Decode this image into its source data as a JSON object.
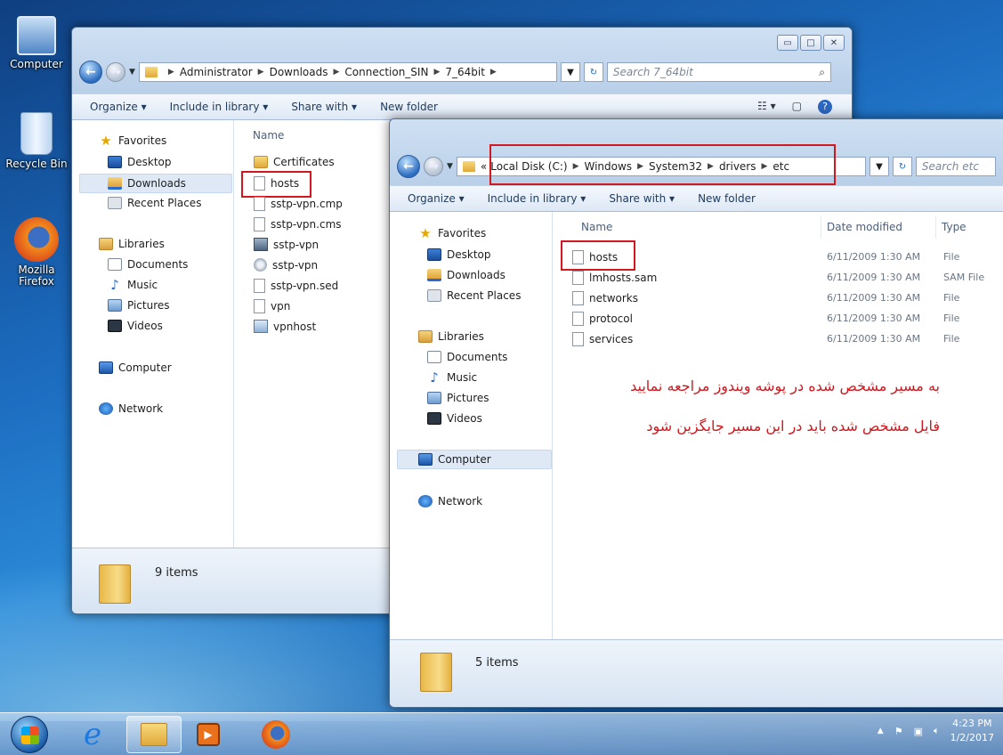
{
  "desktop": {
    "icons": [
      {
        "label": "Computer",
        "icon": "computer-icon"
      },
      {
        "label": "Recycle Bin",
        "icon": "recycle-bin-icon"
      },
      {
        "label": "Mozilla Firefox",
        "icon": "firefox-icon"
      }
    ]
  },
  "window1": {
    "breadcrumb": [
      "Administrator",
      "Downloads",
      "Connection_SIN",
      "7_64bit"
    ],
    "search_placeholder": "Search 7_64bit",
    "toolbar": {
      "organize": "Organize ▾",
      "include": "Include in library ▾",
      "share": "Share with ▾",
      "new_folder": "New folder"
    },
    "nav": {
      "favorites": "Favorites",
      "desktop": "Desktop",
      "downloads": "Downloads",
      "recent": "Recent Places",
      "libraries": "Libraries",
      "documents": "Documents",
      "music": "Music",
      "pictures": "Pictures",
      "videos": "Videos",
      "computer": "Computer",
      "network": "Network"
    },
    "column_name": "Name",
    "files": [
      "Certificates",
      "hosts",
      "sstp-vpn.cmp",
      "sstp-vpn.cms",
      "sstp-vpn",
      "sstp-vpn",
      "sstp-vpn.sed",
      "vpn",
      "vpnhost"
    ],
    "status": "9 items"
  },
  "window2": {
    "breadcrumb_prefix": "«",
    "breadcrumb": [
      "Local Disk (C:)",
      "Windows",
      "System32",
      "drivers",
      "etc"
    ],
    "search_placeholder": "Search etc",
    "toolbar": {
      "organize": "Organize ▾",
      "include": "Include in library ▾",
      "share": "Share with ▾",
      "new_folder": "New folder"
    },
    "nav": {
      "favorites": "Favorites",
      "desktop": "Desktop",
      "downloads": "Downloads",
      "recent": "Recent Places",
      "libraries": "Libraries",
      "documents": "Documents",
      "music": "Music",
      "pictures": "Pictures",
      "videos": "Videos",
      "computer": "Computer",
      "network": "Network"
    },
    "columns": {
      "name": "Name",
      "date": "Date modified",
      "type": "Type"
    },
    "rows": [
      {
        "name": "hosts",
        "date": "6/11/2009 1:30 AM",
        "type": "File"
      },
      {
        "name": "lmhosts.sam",
        "date": "6/11/2009 1:30 AM",
        "type": "SAM File"
      },
      {
        "name": "networks",
        "date": "6/11/2009 1:30 AM",
        "type": "File"
      },
      {
        "name": "protocol",
        "date": "6/11/2009 1:30 AM",
        "type": "File"
      },
      {
        "name": "services",
        "date": "6/11/2009 1:30 AM",
        "type": "File"
      }
    ],
    "annotation_line1": "به مسیر مشخص شده در پوشه ویندوز مراجعه نمایید",
    "annotation_line2": "فایل مشخص شده باید در این مسیر جایگزین شود",
    "status": "5 items"
  },
  "taskbar": {
    "time": "4:23 PM",
    "date": "1/2/2017",
    "apps": [
      "internet-explorer-icon",
      "windows-explorer-icon",
      "media-player-icon",
      "firefox-icon"
    ]
  },
  "colors": {
    "annotation": "#d0181e",
    "selection": "#dfe9f6"
  }
}
